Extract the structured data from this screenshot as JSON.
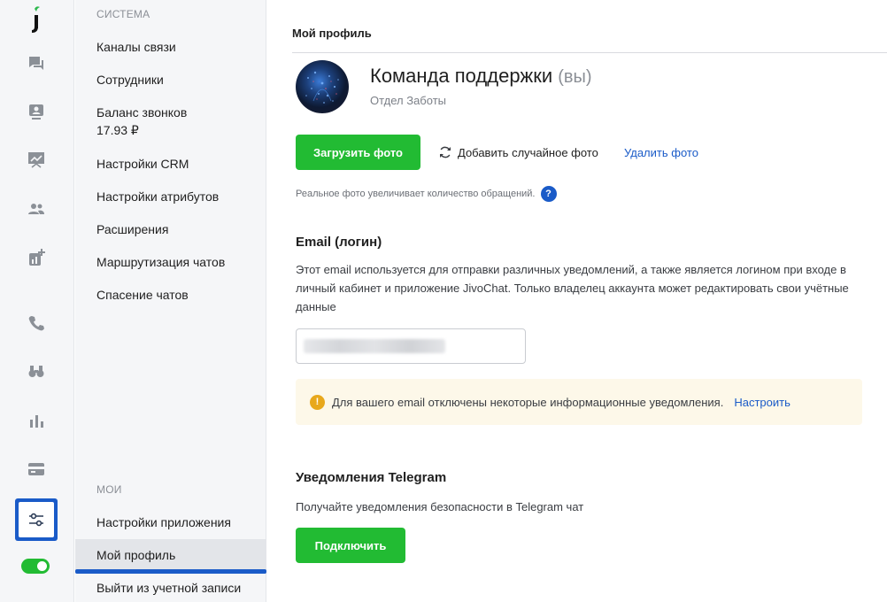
{
  "rail": {
    "logo": "j",
    "icons": [
      "chat-icon",
      "visitors-icon",
      "presentation-icon",
      "team-icon",
      "stats-add-icon",
      "phone-icon",
      "binoculars-icon",
      "bar-chart-icon",
      "billing-card-icon",
      "settings-sliders-icon"
    ],
    "toggle_on": true,
    "accent": "#1a5bc8",
    "green": "#22bb33"
  },
  "sidebar": {
    "system_heading": "СИСТЕМА",
    "system_items": [
      {
        "label": "Каналы связи"
      },
      {
        "label": "Сотрудники"
      },
      {
        "label": "Баланс звонков",
        "sub": "17.93 ₽"
      },
      {
        "label": "Настройки CRM"
      },
      {
        "label": "Настройки атрибутов"
      },
      {
        "label": "Расширения"
      },
      {
        "label": "Маршрутизация чатов"
      },
      {
        "label": "Спасение чатов"
      }
    ],
    "my_heading": "МОИ",
    "my_items": [
      {
        "label": "Настройки приложения"
      },
      {
        "label": "Мой профиль"
      },
      {
        "label": "Выйти из учетной записи"
      }
    ]
  },
  "main": {
    "page_title": "Мой профиль",
    "profile": {
      "name": "Команда поддержки",
      "you": "(вы)",
      "department": "Отдел Заботы"
    },
    "photo": {
      "upload_label": "Загрузить фото",
      "random_label": "Добавить случайное фото",
      "delete_label": "Удалить фото",
      "hint": "Реальное фото увеличивает количество обращений.",
      "help_glyph": "?"
    },
    "email": {
      "title": "Email (логин)",
      "description": "Этот email используется для отправки различных уведомлений, а также является логином при входе в личный кабинет и приложение JivoChat. Только владелец аккаунта может редактировать свои учётные данные",
      "notice": "Для вашего email отключены некоторые информационные уведомления.",
      "notice_link": "Настроить",
      "warn_glyph": "!"
    },
    "telegram": {
      "title": "Уведомления Telegram",
      "description": "Получайте уведомления безопасности в Telegram чат",
      "connect_label": "Подключить"
    }
  }
}
